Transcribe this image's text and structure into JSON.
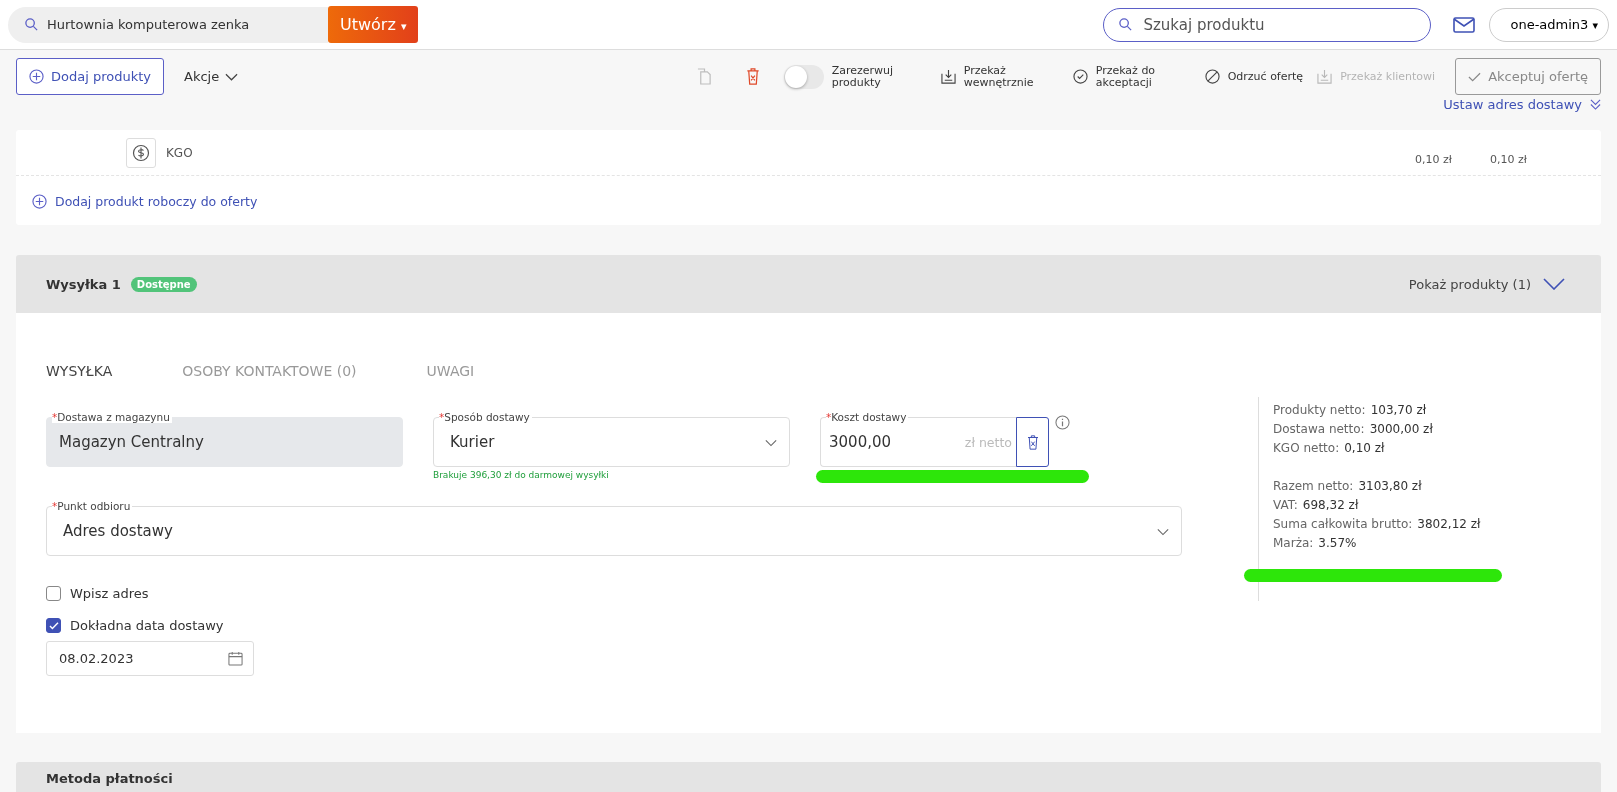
{
  "top_bar": {
    "company_search": {
      "value": "Hurtownia komputerowa zenka"
    },
    "create_button": {
      "label": "Utwórz",
      "caret": "▾"
    },
    "product_search": {
      "placeholder": "Szukaj produktu"
    },
    "user_menu": {
      "label": "one-admin3",
      "caret": "▾"
    }
  },
  "toolbar": {
    "add_button": "Dodaj produkty",
    "actions_menu": "Akcje",
    "actions": [
      {
        "kind": "copy",
        "disabled": true
      },
      {
        "kind": "delete",
        "disabled": false
      },
      {
        "kind": "toggle",
        "label": "Zarezerwuj produkty",
        "on": false
      },
      {
        "kind": "transfer",
        "label": "Przekaż wewnętrznie",
        "disabled": false
      },
      {
        "kind": "approve",
        "label": "Przekaż do akceptacji",
        "disabled": false
      },
      {
        "kind": "reject",
        "label": "Odrzuć ofertę",
        "disabled": false
      },
      {
        "kind": "client",
        "label": "Przekaż klientowi",
        "disabled": true
      }
    ],
    "accept_button": {
      "label": "Akceptuj ofertę",
      "disabled": true
    },
    "address_link": "Ustaw adres dostawy"
  },
  "products": {
    "fee_row": {
      "name": "KGO",
      "price_1": "0,10 zł",
      "price_2": "0,10 zł"
    },
    "add_draft_link": "Dodaj produkt roboczy do oferty"
  },
  "shipment": {
    "title": "Wysyłka 1",
    "status": "Dostępne",
    "show_products": "Pokaż produkty (1)",
    "tabs": [
      {
        "label": "WYSYŁKA",
        "selected": true
      },
      {
        "label": "OSOBY KONTAKTOWE (0)",
        "selected": false
      },
      {
        "label": "UWAGI",
        "selected": false
      }
    ],
    "warehouse": {
      "required_mark": "*",
      "label": "Dostawa z magazynu",
      "value": "Magazyn Centralny",
      "disabled": true
    },
    "method": {
      "required_mark": "*",
      "label": "Sposób dostawy",
      "value": "Kurier",
      "hint": "Brakuje 396,30 zł do darmowej wysyłki"
    },
    "cost": {
      "required_mark": "*",
      "label": "Koszt dostawy",
      "value": "3000,00",
      "unit": "zł netto"
    },
    "pickup": {
      "required_mark": "*",
      "label": "Punkt odbioru",
      "value": "Adres dostawy"
    },
    "checkboxes": [
      {
        "label": "Wpisz adres",
        "checked": false
      },
      {
        "label": "Dokładna data dostawy",
        "checked": true
      }
    ],
    "date": {
      "value": "08.02.2023"
    },
    "summary_groups": [
      [
        {
          "label": "Produkty netto:",
          "value": "103,70 zł"
        },
        {
          "label": "Dostawa netto:",
          "value": "3000,00 zł"
        },
        {
          "label": "KGO netto:",
          "value": "0,10 zł"
        }
      ],
      [
        {
          "label": "Razem netto:",
          "value": "3103,80 zł"
        },
        {
          "label": "VAT:",
          "value": "698,32 zł"
        },
        {
          "label": "Suma całkowita brutto:",
          "value": "3802,12 zł"
        },
        {
          "label": "Marża:",
          "value": "3.57%"
        }
      ]
    ]
  },
  "payment": {
    "title": "Metoda płatności"
  }
}
